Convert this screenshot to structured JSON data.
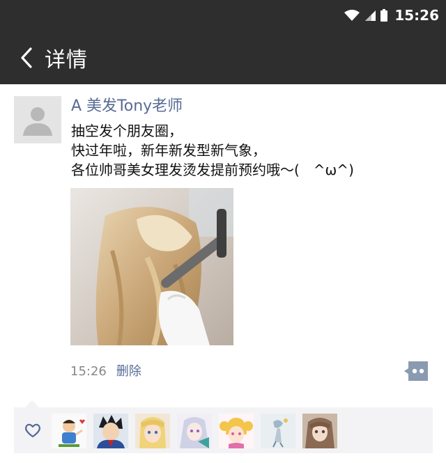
{
  "status_bar": {
    "time": "15:26"
  },
  "header": {
    "title": "详情"
  },
  "post": {
    "author": "A 美发Tony老师",
    "lines": [
      "抽空发个朋友圈，",
      "快过年啦，新年新发型新气象，",
      "各位帅哥美女理发烫发提前预约哦～(　^ω^)"
    ],
    "time": "15:26",
    "delete_label": "删除"
  },
  "likes": {
    "count_shown": 7
  },
  "colors": {
    "topbar": "#2e2e2e",
    "link": "#576b95",
    "likes_bg": "#f3f3f5"
  }
}
